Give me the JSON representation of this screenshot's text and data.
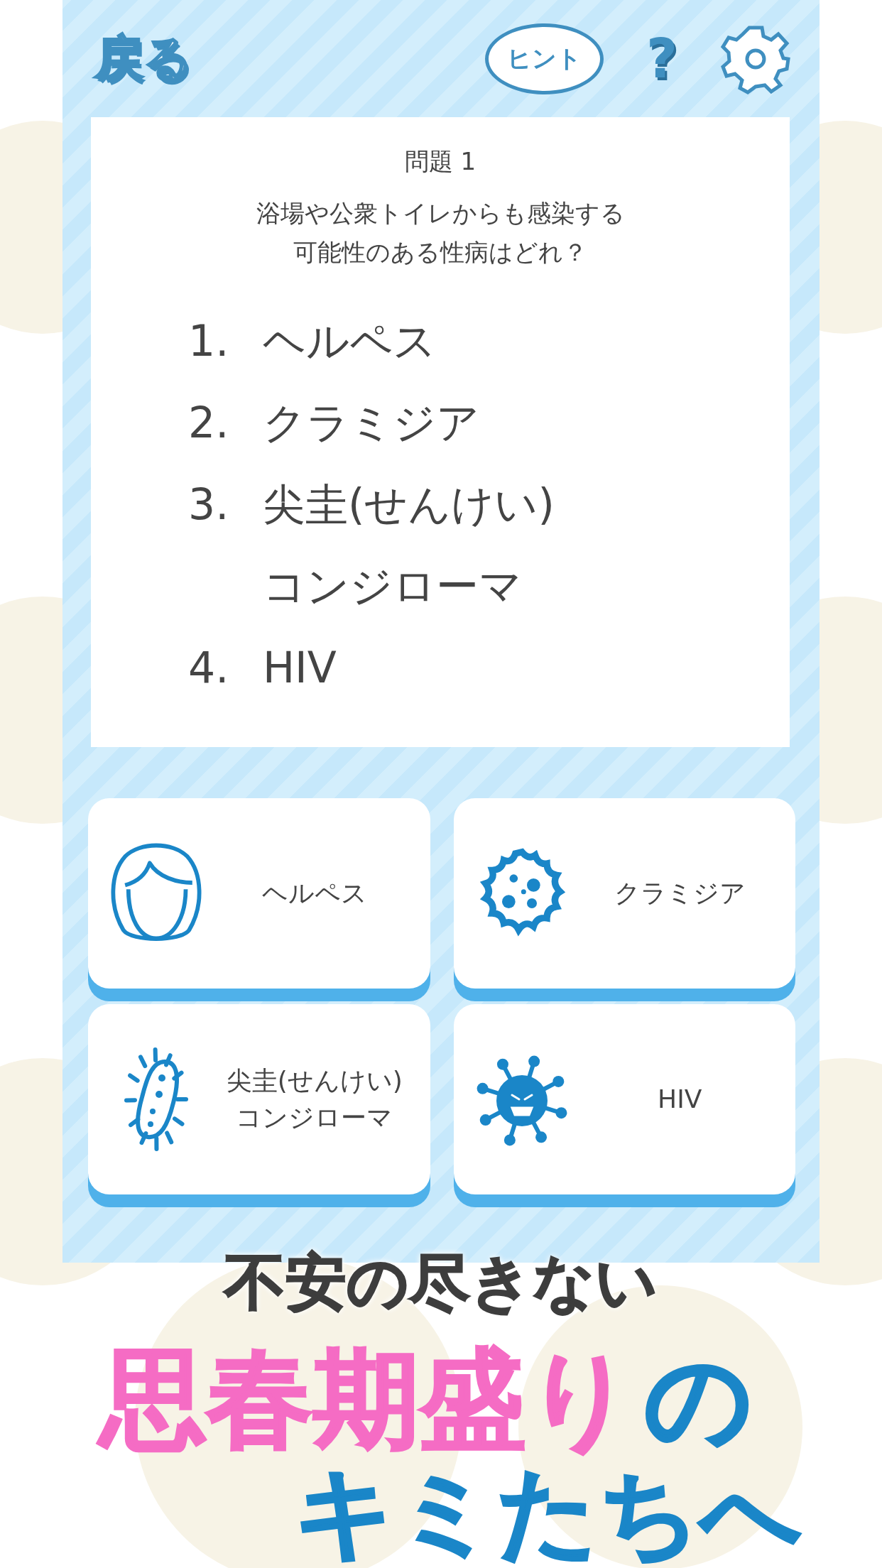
{
  "toolbar": {
    "back": "戻る",
    "hint": "ヒント",
    "help": "?"
  },
  "question": {
    "title": "問題 1",
    "text": [
      "浴場や公衆トイレからも感染する",
      "可能性のある性病はどれ？"
    ],
    "options": [
      {
        "number": "1.",
        "lines": [
          "ヘルペス"
        ]
      },
      {
        "number": "2.",
        "lines": [
          "クラミジア"
        ]
      },
      {
        "number": "3.",
        "lines": [
          "尖圭(せんけい)",
          "コンジローマ"
        ]
      },
      {
        "number": "4.",
        "lines": [
          "HIV"
        ]
      }
    ]
  },
  "answers": [
    {
      "kind": "person",
      "lines": [
        "ヘルペス"
      ]
    },
    {
      "kind": "germ",
      "lines": [
        "クラミジア"
      ]
    },
    {
      "kind": "bacterium",
      "lines": [
        "尖圭(せんけい)",
        "コンジローマ"
      ]
    },
    {
      "kind": "virus",
      "lines": [
        "HIV"
      ]
    }
  ],
  "tagline": {
    "line_1": "不安の尽きない",
    "line_2": [
      {
        "text": "思春期盛り",
        "color": "#f56cc4"
      },
      {
        "text": "の",
        "color": "#1a86c8"
      }
    ],
    "line_3": "キミたちへ"
  }
}
